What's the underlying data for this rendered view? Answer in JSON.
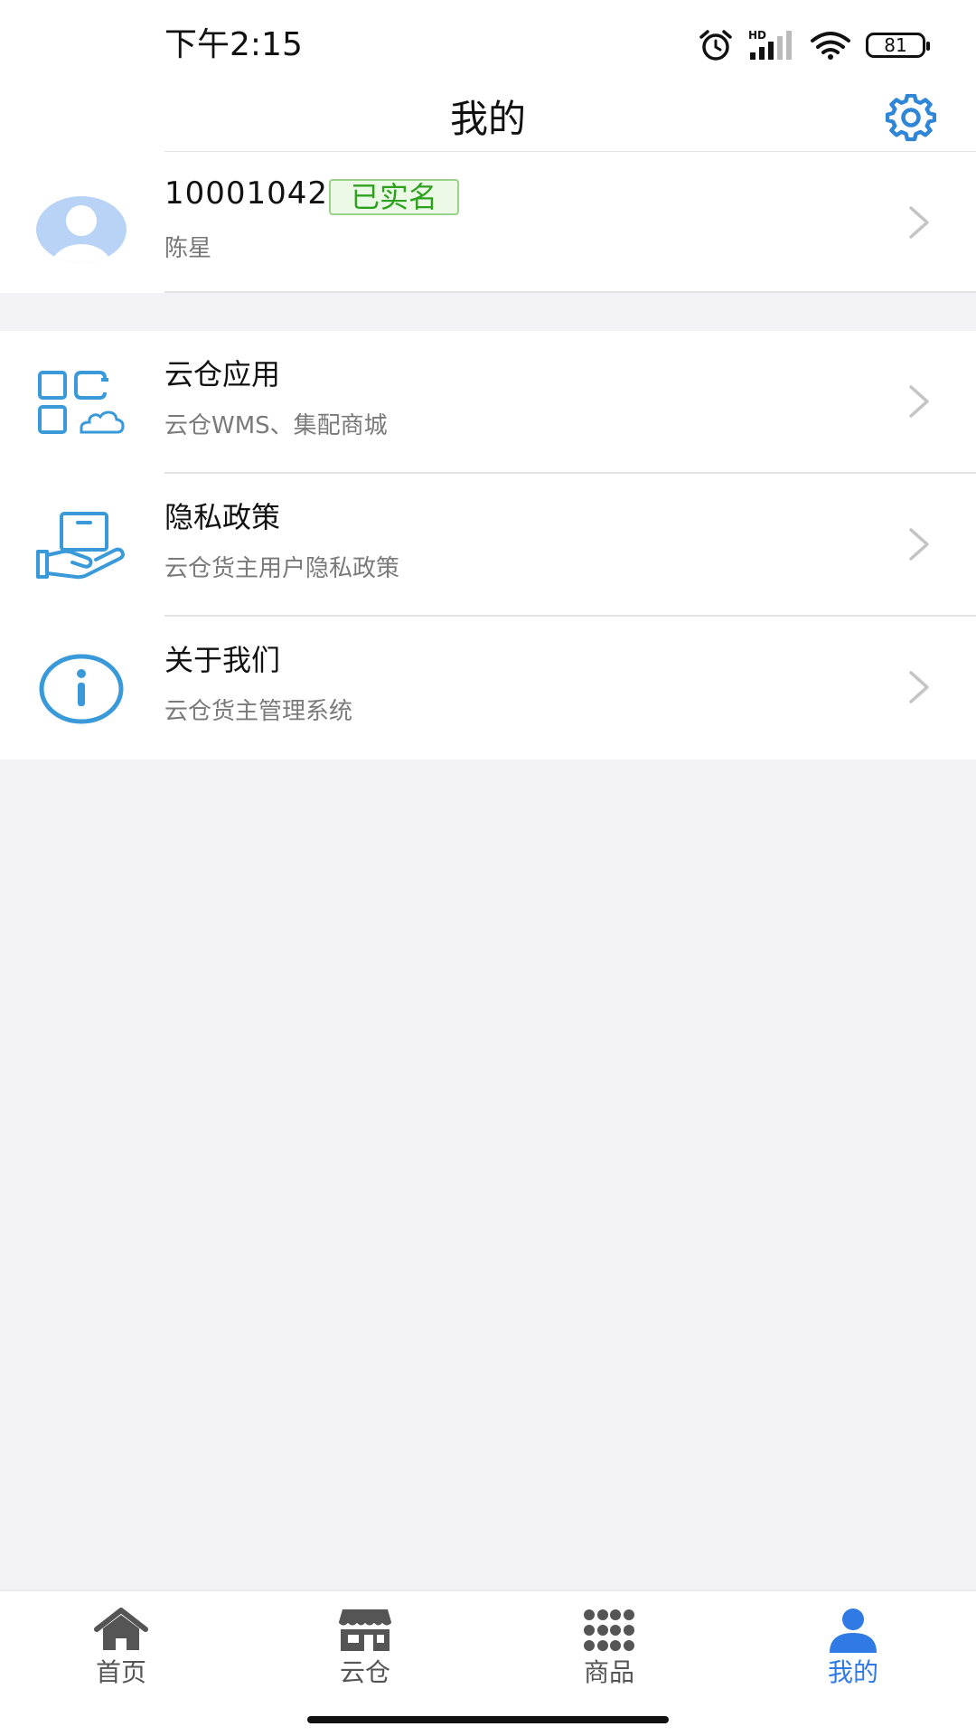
{
  "status_bar": {
    "time": "下午2:15",
    "hd_label": "HD",
    "battery": "81"
  },
  "header": {
    "title": "我的"
  },
  "profile": {
    "user_id": "10001042",
    "verified_badge": "已实名",
    "name": "陈星"
  },
  "menu": {
    "items": [
      {
        "title": "云仓应用",
        "subtitle": "云仓WMS、集配商城",
        "icon": "apps-cloud-icon"
      },
      {
        "title": "隐私政策",
        "subtitle": "云仓货主用户隐私政策",
        "icon": "hand-box-icon"
      },
      {
        "title": "关于我们",
        "subtitle": "云仓货主管理系统",
        "icon": "info-icon"
      }
    ]
  },
  "tabbar": {
    "tabs": [
      {
        "label": "首页",
        "icon": "home-icon"
      },
      {
        "label": "云仓",
        "icon": "store-icon"
      },
      {
        "label": "商品",
        "icon": "grid-dots-icon"
      },
      {
        "label": "我的",
        "icon": "user-icon"
      }
    ],
    "active_index": 3
  },
  "colors": {
    "accent": "#2f7ae5",
    "icon_blue": "#3a9ad9",
    "verified_green": "#2ea11f",
    "background": "#f2f2f7"
  }
}
